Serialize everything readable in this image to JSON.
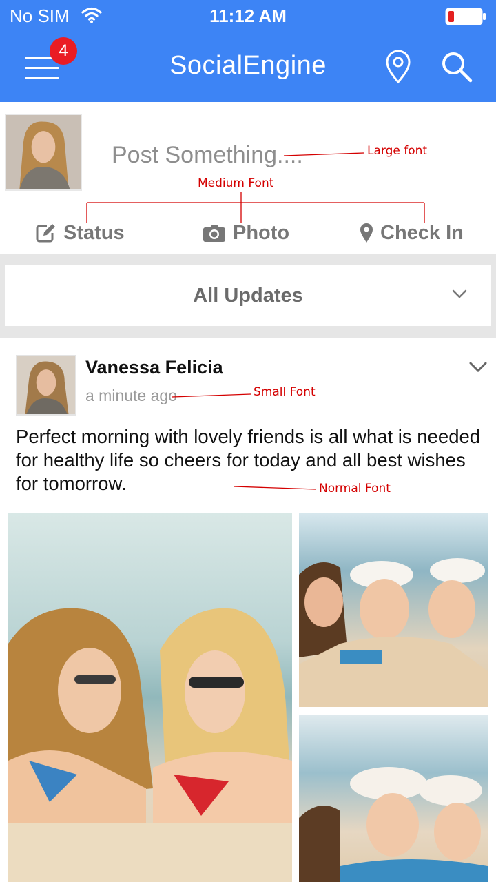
{
  "status_bar": {
    "carrier": "No SIM",
    "time": "11:12 AM"
  },
  "header": {
    "title": "SocialEngine",
    "notification_count": "4"
  },
  "composer": {
    "placeholder": "Post Something....",
    "actions": [
      {
        "label": "Status",
        "icon": "edit-icon"
      },
      {
        "label": "Photo",
        "icon": "camera-icon"
      },
      {
        "label": "Check In",
        "icon": "map-pin-icon"
      }
    ]
  },
  "filter": {
    "label": "All Updates"
  },
  "post": {
    "author": "Vanessa Felicia",
    "timestamp": "a minute ago",
    "text": "Perfect morning with lovely friends is all what is needed for healthy life so cheers for today and all best wishes for tomorrow."
  },
  "annotations": {
    "large": "Large font",
    "medium": "Medium Font",
    "small": "Small Font",
    "normal": "Normal Font"
  },
  "colors": {
    "header": "#3d84f5",
    "badge": "#ea1c24",
    "annotation": "#d40000",
    "muted_text": "#777777"
  }
}
